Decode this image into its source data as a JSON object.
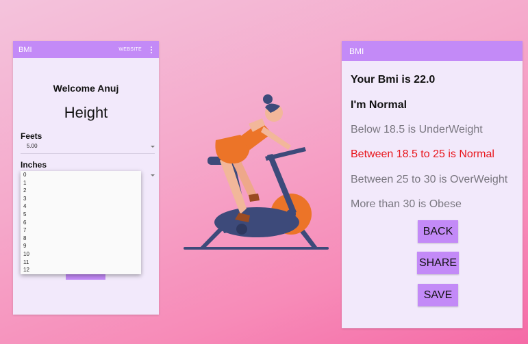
{
  "left_screen": {
    "appbar": {
      "title": "BMI",
      "website_link": "WEBSITE"
    },
    "welcome": "Welcome Anuj",
    "heading": "Height",
    "feet": {
      "label": "Feets",
      "value": "5.00"
    },
    "inches": {
      "label": "Inches",
      "options": [
        "0",
        "1",
        "2",
        "3",
        "4",
        "5",
        "6",
        "7",
        "8",
        "9",
        "10",
        "11",
        "12"
      ]
    }
  },
  "right_screen": {
    "appbar": {
      "title": "BMI"
    },
    "result": "Your Bmi is 22.0",
    "status": "I'm Normal",
    "ranges": [
      {
        "text": "Below 18.5 is UnderWeight",
        "highlight": false
      },
      {
        "text": "Between 18.5 to 25 is Normal",
        "highlight": true
      },
      {
        "text": "Between 25 to 30  is OverWeight",
        "highlight": false
      },
      {
        "text": "More than 30 is Obese",
        "highlight": false
      }
    ],
    "buttons": {
      "back": "BACK",
      "share": "SHARE",
      "save": "SAVE"
    }
  },
  "colors": {
    "appbar": "#c38af7",
    "screen_bg": "#f2e9fb",
    "highlight": "#e8151b",
    "bike_frame": "#3d4a7a",
    "accent_orange": "#ec7428"
  },
  "illustration": {
    "icon": "woman-exercise-bike-illustration"
  }
}
